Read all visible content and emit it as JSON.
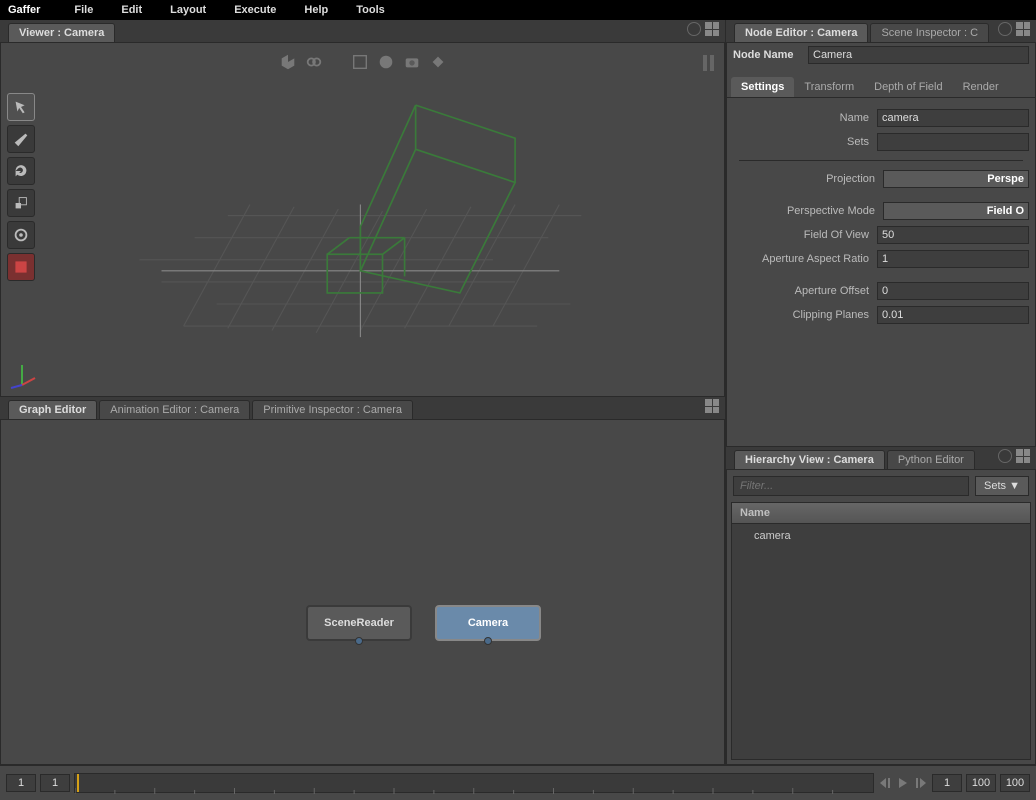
{
  "menubar": {
    "logo": "Gaffer",
    "items": [
      "File",
      "Edit",
      "Layout",
      "Execute",
      "Help",
      "Tools"
    ]
  },
  "viewer": {
    "tab_title": "Viewer : Camera"
  },
  "graph_editor": {
    "tabs": [
      "Graph Editor",
      "Animation Editor : Camera",
      "Primitive Inspector : Camera"
    ],
    "nodes": {
      "scene_reader": "SceneReader",
      "camera": "Camera"
    }
  },
  "node_editor": {
    "tabs": [
      "Node Editor : Camera",
      "Scene Inspector : C"
    ],
    "node_name_label": "Node Name",
    "node_name_value": "Camera",
    "subtabs": [
      "Settings",
      "Transform",
      "Depth of Field",
      "Render"
    ],
    "fields": {
      "name": {
        "label": "Name",
        "value": "camera"
      },
      "sets": {
        "label": "Sets",
        "value": ""
      },
      "projection": {
        "label": "Projection",
        "value": "Perspe"
      },
      "perspective_mode": {
        "label": "Perspective Mode",
        "value": "Field O"
      },
      "field_of_view": {
        "label": "Field Of View",
        "value": "50"
      },
      "aperture_aspect": {
        "label": "Aperture Aspect Ratio",
        "value": "1"
      },
      "aperture_offset": {
        "label": "Aperture Offset",
        "value": "0"
      },
      "clipping_planes": {
        "label": "Clipping Planes",
        "value": "0.01"
      }
    }
  },
  "hierarchy": {
    "tabs": [
      "Hierarchy View : Camera",
      "Python Editor"
    ],
    "filter_placeholder": "Filter...",
    "sets_label": "Sets ▼",
    "header": "Name",
    "items": [
      "camera"
    ]
  },
  "timeline": {
    "start": "1",
    "current": "1",
    "end": "100",
    "total": "100"
  }
}
